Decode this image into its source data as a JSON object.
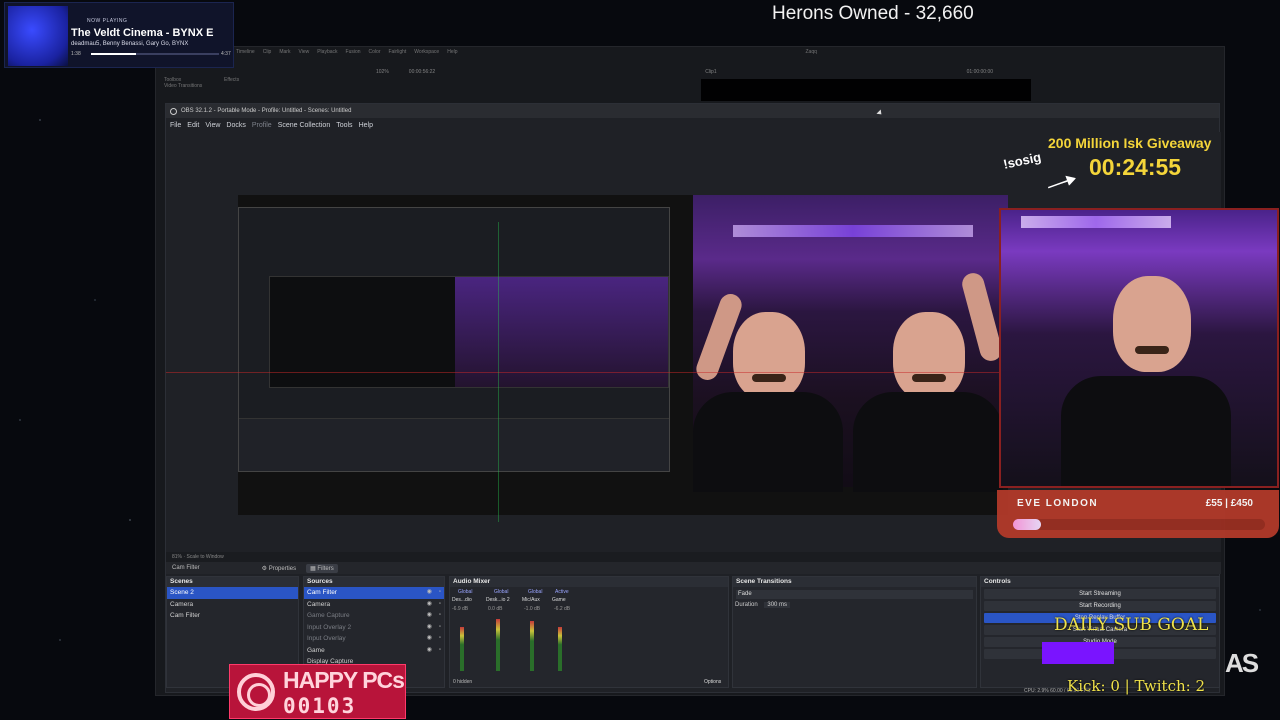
{
  "now_playing": {
    "tag": "NOW PLAYING",
    "title": "The Veldt Cinema - BYNX E",
    "artist": "deadmau5, Benny Benassi, Gary Go, BYNX",
    "elapsed": "1:38",
    "duration": "4:37",
    "progress": 0.35
  },
  "herons": "Herons Owned - 32,660",
  "giveaway": {
    "title": "200 Million Isk Giveaway",
    "timer": "00:24:55",
    "command": "!sosig"
  },
  "goal": {
    "name": "EVE LONDON",
    "amount": "£55 | £450",
    "progress": 0.11
  },
  "daily_sub": "DAILY SUB GOAL",
  "kick": "Kick: 0 | Twitch: 2",
  "happy": {
    "title": "HAPPY PCs",
    "count": "00103"
  },
  "corner_text": "AS",
  "bg_editor": {
    "menu": [
      "Timeline",
      "Clip",
      "Mark",
      "View",
      "Playback",
      "Fusion",
      "Color",
      "Fairlight",
      "Workspace",
      "Help"
    ],
    "timecode": "00:00:56:22",
    "zoom": "102%",
    "project": "Zaqq",
    "clip": "Clip1",
    "timeline_tc": "01:00:00:00",
    "panels": [
      "Toolbox",
      "Video Transitions",
      "Effects"
    ]
  },
  "obs": {
    "title": "OBS 32.1.2 - Portable Mode - Profile: Untitled - Scenes: Untitled",
    "menu": [
      "File",
      "Edit",
      "View",
      "Docks",
      "Profile",
      "Scene Collection",
      "Tools",
      "Help"
    ],
    "status_strip": "81%  ·  Scale to Window",
    "toolbar": {
      "source": "Cam Filter",
      "properties": "Properties",
      "filters": "Filters"
    },
    "scenes": {
      "title": "Scenes",
      "items": [
        "Scene 2",
        "Camera",
        "Cam Filter"
      ]
    },
    "sources": {
      "title": "Sources",
      "items": [
        "Cam Filter",
        "Camera",
        "Game Capture",
        "Input Overlay 2",
        "Input Overlay",
        "Game",
        "Display Capture"
      ]
    },
    "audio": {
      "title": "Audio Mixer",
      "channels": [
        "Des...dio",
        "Desk...io 2",
        "Mic/Aux",
        "Game"
      ],
      "global_tag": "Global",
      "active_tag": "Active",
      "levels": [
        "-6.9 dB",
        "0.0 dB",
        "-1.0 dB",
        "-6.2 dB"
      ],
      "hidden": "0 hidden",
      "options": "Options"
    },
    "transitions": {
      "title": "Scene Transitions",
      "type": "Fade",
      "duration_label": "Duration",
      "duration": "300 ms"
    },
    "controls": {
      "title": "Controls",
      "buttons": [
        "Start Streaming",
        "Start Recording",
        "Stop Replay Buffer",
        "Start Virtual Camera",
        "Studio Mode",
        "Settings"
      ]
    },
    "stats": "CPU: 2.9%  60.00 / 60.00 FPS"
  },
  "colors": {
    "accent": "#2a55c5",
    "gold": "#f4d53a",
    "goal": "#b23a2a",
    "happy": "#b8143a"
  }
}
